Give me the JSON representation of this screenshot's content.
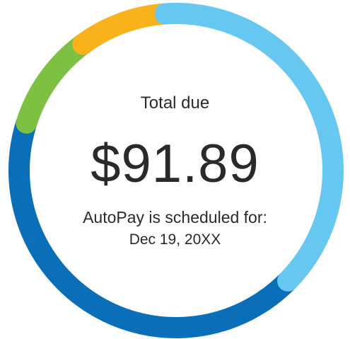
{
  "summary": {
    "total_label": "Total due",
    "amount": "$91.89",
    "autopay_text": "AutoPay is scheduled for:",
    "autopay_date": "Dec 19, 20XX"
  },
  "ring": {
    "colors": {
      "light_blue": "#66C8F0",
      "dark_blue": "#0A6FB8",
      "green": "#7DC142",
      "orange": "#F9B21A"
    },
    "segments": [
      {
        "color": "light_blue",
        "fraction": 0.385
      },
      {
        "color": "dark_blue",
        "fraction": 0.425
      },
      {
        "color": "green",
        "fraction": 0.1
      },
      {
        "color": "orange",
        "fraction": 0.09
      }
    ]
  }
}
